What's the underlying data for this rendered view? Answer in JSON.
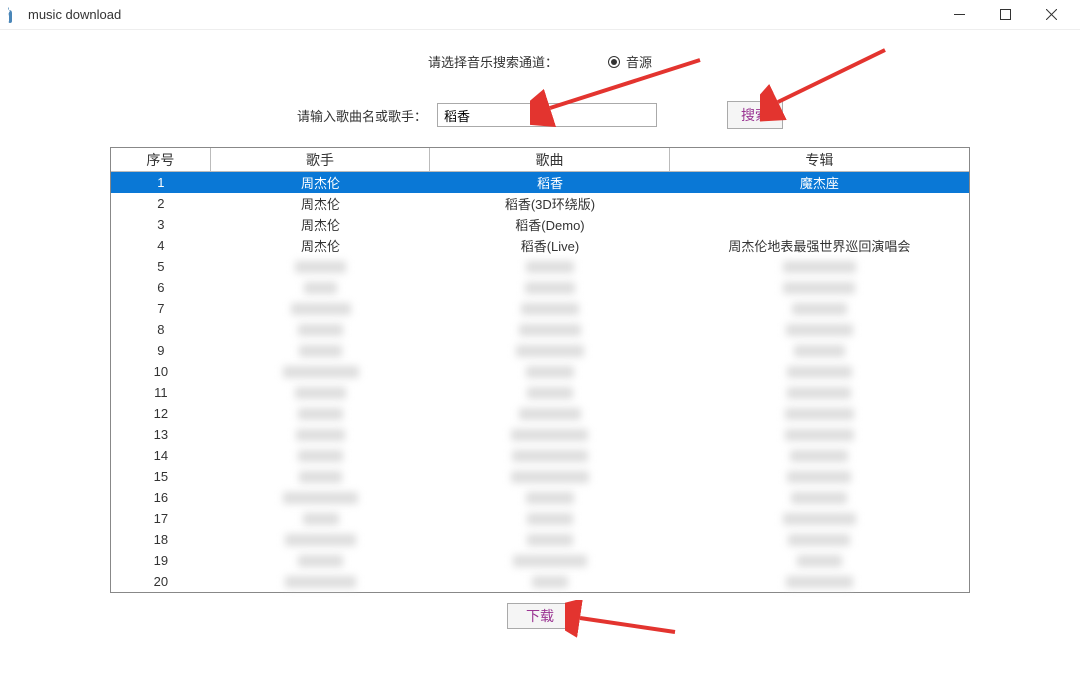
{
  "window": {
    "title": "music download"
  },
  "channel": {
    "label": "请选择音乐搜索通道：",
    "option": "音源"
  },
  "search": {
    "hint": "请输入歌曲名或歌手：",
    "value": "稻香",
    "button": "搜索"
  },
  "columns": {
    "idx": "序号",
    "singer": "歌手",
    "song": "歌曲",
    "album": "专辑"
  },
  "rows": [
    {
      "n": "1",
      "singer": "周杰伦",
      "song": "稻香",
      "album": "魔杰座",
      "selected": true,
      "blur": false
    },
    {
      "n": "2",
      "singer": "周杰伦",
      "song": "稻香(3D环绕版)",
      "album": "",
      "blur": false
    },
    {
      "n": "3",
      "singer": "周杰伦",
      "song": "稻香(Demo)",
      "album": "",
      "blur": false
    },
    {
      "n": "4",
      "singer": "周杰伦",
      "song": "稻香(Live)",
      "album": "周杰伦地表最强世界巡回演唱会",
      "blur": false
    },
    {
      "n": "5",
      "blur": true
    },
    {
      "n": "6",
      "blur": true
    },
    {
      "n": "7",
      "blur": true
    },
    {
      "n": "8",
      "blur": true
    },
    {
      "n": "9",
      "blur": true
    },
    {
      "n": "10",
      "blur": true
    },
    {
      "n": "11",
      "blur": true
    },
    {
      "n": "12",
      "blur": true
    },
    {
      "n": "13",
      "blur": true
    },
    {
      "n": "14",
      "blur": true
    },
    {
      "n": "15",
      "blur": true
    },
    {
      "n": "16",
      "blur": true
    },
    {
      "n": "17",
      "blur": true
    },
    {
      "n": "18",
      "blur": true
    },
    {
      "n": "19",
      "blur": true
    },
    {
      "n": "20",
      "blur": true
    }
  ],
  "download": "下载"
}
